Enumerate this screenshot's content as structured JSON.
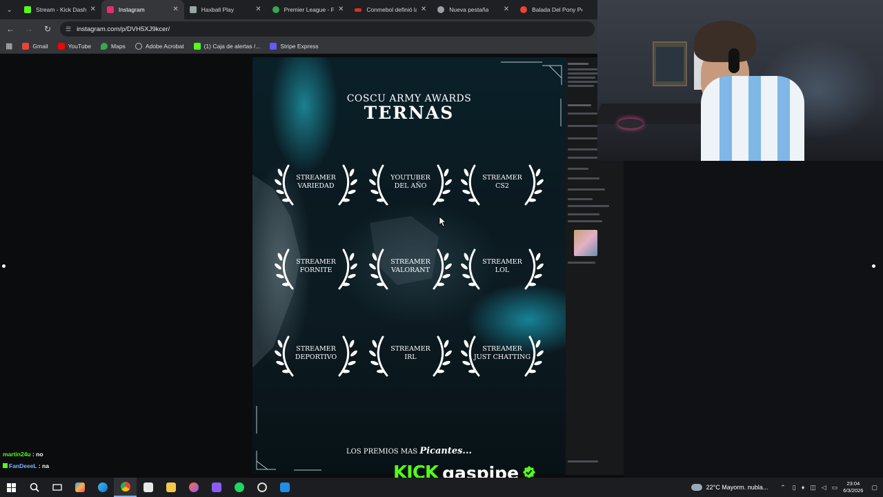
{
  "browser": {
    "tabs": [
      {
        "label": "Stream - Kick Dashbo",
        "favicon_color": "#53fc18"
      },
      {
        "label": "Instagram",
        "favicon_color": "#e1306c",
        "active": true
      },
      {
        "label": "Haxball Play",
        "favicon_color": "#9aa6a0"
      },
      {
        "label": "Premier League - PO",
        "favicon_color": "#34a853"
      },
      {
        "label": "Conmebol definió la",
        "favicon_color": "#d93025"
      },
      {
        "label": "Nueva pestaña",
        "favicon_color": "#9aa0a6"
      },
      {
        "label": "Balada Del Pony Pela",
        "favicon_color": "#ea4335"
      }
    ],
    "url": "instagram.com/p/DVH5XJ9kcer/",
    "bookmarks": [
      {
        "label": "Gmail",
        "color": "#ea4335"
      },
      {
        "label": "YouTube",
        "color": "#ff0000"
      },
      {
        "label": "Maps",
        "color": "#34a853"
      },
      {
        "label": "Adobe Acrobat",
        "color": "#bbbbbb"
      },
      {
        "label": "(1) Caja de alertas /...",
        "color": "#53fc18"
      },
      {
        "label": "Stripe Express",
        "color": "#635bff"
      }
    ]
  },
  "post": {
    "subtitle": "COSCU ARMY AWARDS",
    "title": "TERNAS",
    "awards": [
      {
        "line1": "STREAMER",
        "line2": "VARIEDAD"
      },
      {
        "line1": "YOUTUBER",
        "line2": "DEL AÑO"
      },
      {
        "line1": "STREAMER",
        "line2": "CS2"
      },
      {
        "line1": "STREAMER",
        "line2": "FORNITE"
      },
      {
        "line1": "STREAMER",
        "line2": "VALORANT"
      },
      {
        "line1": "STREAMER",
        "line2": "LOL"
      },
      {
        "line1": "STREAMER",
        "line2": "DEPORTIVO"
      },
      {
        "line1": "STREAMER",
        "line2": "IRL"
      },
      {
        "line1": "STREAMER",
        "line2": "JUST CHATTING"
      }
    ],
    "footer_prefix": "LOS PREMIOS MAS",
    "footer_emph": "Picantes..."
  },
  "overlay_chat": [
    {
      "user": "martin24u",
      "message": " : no",
      "color": "#53fc18"
    },
    {
      "user": "FanDeeeL",
      "message": " : na",
      "color": "#7db7ff"
    }
  ],
  "brand": {
    "platform": "KICK",
    "username": "gaspipe"
  },
  "taskbar": {
    "weather": "22°C  Mayorm. nubla...",
    "time": "23:04",
    "date": "6/3/2026"
  }
}
